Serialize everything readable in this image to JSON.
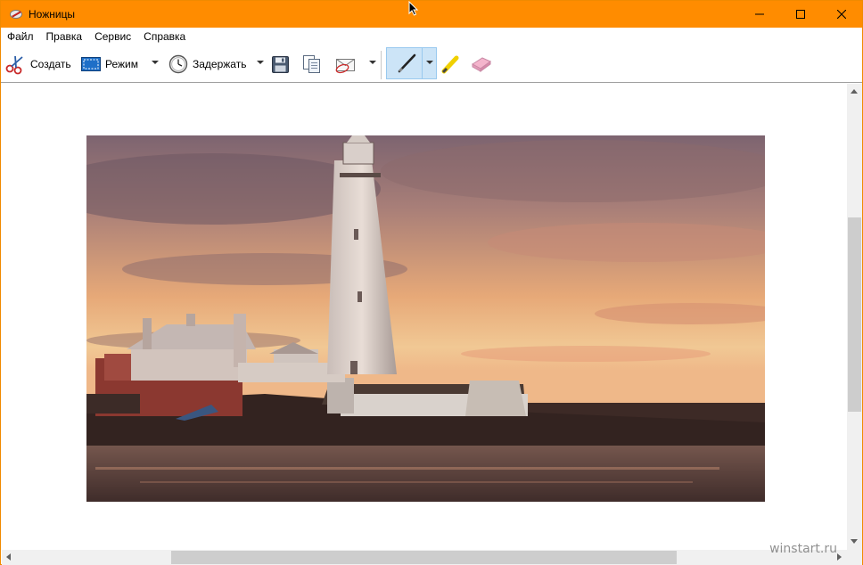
{
  "window": {
    "title": "Ножницы",
    "app_icon": "scissors-icon",
    "controls": [
      "minimize-icon",
      "maximize-icon",
      "close-icon"
    ]
  },
  "menu": {
    "items": [
      "Файл",
      "Правка",
      "Сервис",
      "Справка"
    ]
  },
  "toolbar": {
    "create_label": "Создать",
    "mode_label": "Режим",
    "delay_label": "Задержать",
    "icons": {
      "create": "scissors-icon",
      "mode": "rectangle-mode-icon",
      "delay": "clock-icon",
      "save": "floppy-disk-icon",
      "copy": "copy-icon",
      "send": "envelope-icon",
      "pen": "pen-icon",
      "highlighter": "highlighter-icon",
      "eraser": "eraser-icon"
    },
    "active_tool": "pen"
  },
  "content": {
    "image_subject": "lighthouse-at-sunset-photo"
  },
  "watermark": "winstart.ru",
  "colors": {
    "titlebar": "#ff8c00",
    "selection": "#cce4f7"
  }
}
